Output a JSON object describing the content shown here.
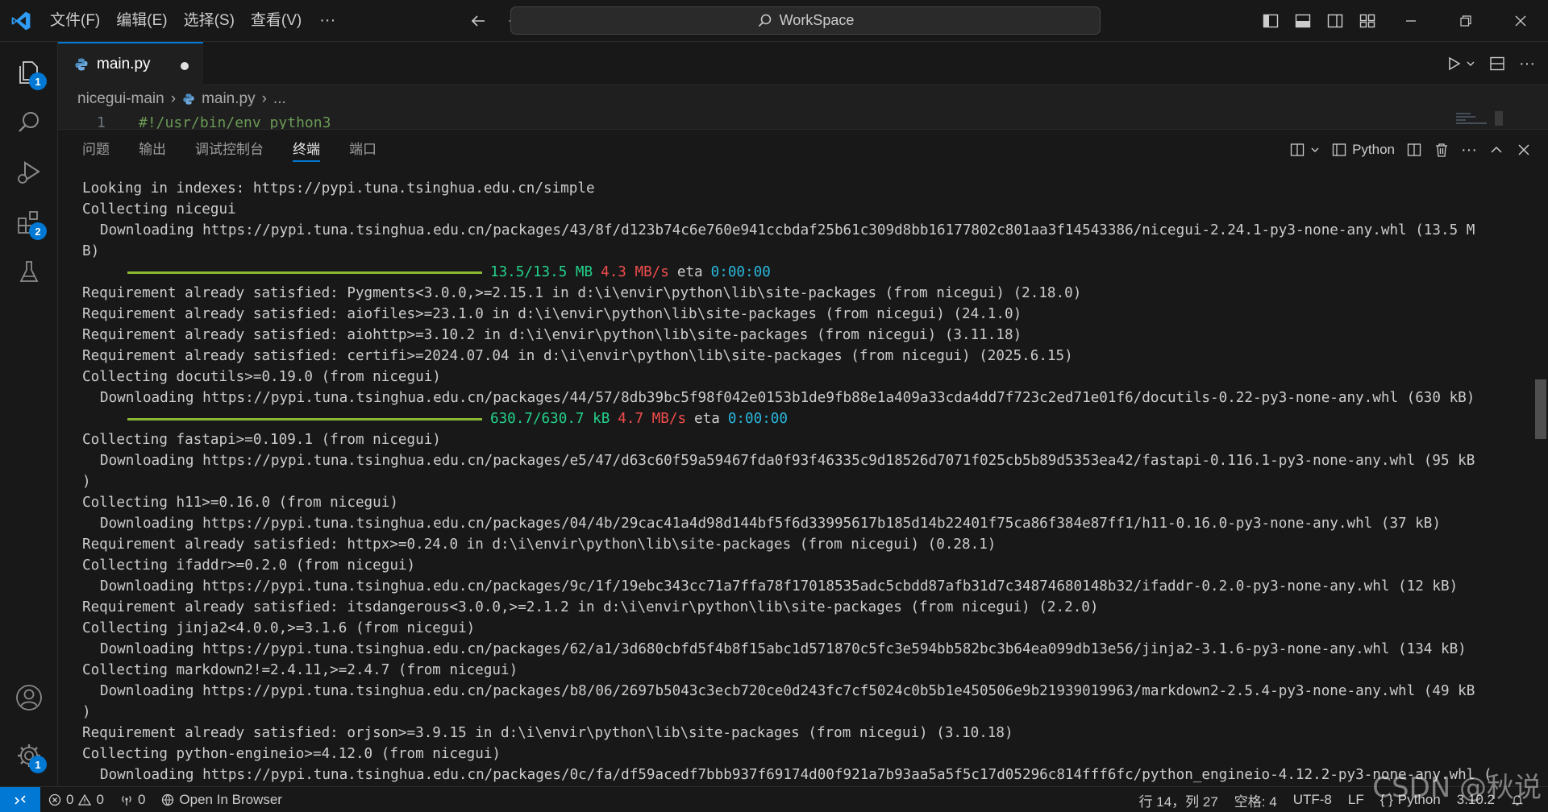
{
  "menu": [
    "文件(F)",
    "编辑(E)",
    "选择(S)",
    "查看(V)"
  ],
  "search": {
    "label": "WorkSpace"
  },
  "activity_badges": {
    "explorer": "1",
    "extensions": "2",
    "settings": "1"
  },
  "tabs": [
    {
      "label": "main.py",
      "dirty": true
    }
  ],
  "breadcrumb": {
    "folder": "nicegui-main",
    "file": "main.py",
    "more": "..."
  },
  "editor": {
    "line_no": "1",
    "code": "#!/usr/bin/env python3"
  },
  "panel": {
    "tabs": [
      "问题",
      "输出",
      "调试控制台",
      "终端",
      "端口"
    ],
    "active_tab": "终端",
    "terminal_profile": "Python"
  },
  "terminal": {
    "lines": [
      {
        "text": "Looking in indexes: https://pypi.tuna.tsinghua.edu.cn/simple"
      },
      {
        "text": "Collecting nicegui"
      },
      {
        "text": "Downloading https://pypi.tuna.tsinghua.edu.cn/packages/43/8f/d123b74c6e760e941ccbdaf25b61c309d8bb16177802c801aa3f14543386/nicegui-2.24.1-py3-none-any.whl (13.5 M",
        "indent": true
      },
      {
        "text": "B)"
      },
      {
        "progress": {
          "size": "13.5/13.5 MB",
          "rate": "4.3 MB/s",
          "eta_label": "eta",
          "eta": "0:00:00",
          "fraction": 1.0
        }
      },
      {
        "text": "Requirement already satisfied: Pygments<3.0.0,>=2.15.1 in d:\\i\\envir\\python\\lib\\site-packages (from nicegui) (2.18.0)"
      },
      {
        "text": "Requirement already satisfied: aiofiles>=23.1.0 in d:\\i\\envir\\python\\lib\\site-packages (from nicegui) (24.1.0)"
      },
      {
        "text": "Requirement already satisfied: aiohttp>=3.10.2 in d:\\i\\envir\\python\\lib\\site-packages (from nicegui) (3.11.18)"
      },
      {
        "text": "Requirement already satisfied: certifi>=2024.07.04 in d:\\i\\envir\\python\\lib\\site-packages (from nicegui) (2025.6.15)"
      },
      {
        "text": "Collecting docutils>=0.19.0 (from nicegui)"
      },
      {
        "text": "Downloading https://pypi.tuna.tsinghua.edu.cn/packages/44/57/8db39bc5f98f042e0153b1de9fb88e1a409a33cda4dd7f723c2ed71e01f6/docutils-0.22-py3-none-any.whl (630 kB)",
        "indent": true
      },
      {
        "progress": {
          "size": "630.7/630.7 kB",
          "rate": "4.7 MB/s",
          "eta_label": "eta",
          "eta": "0:00:00",
          "fraction": 1.0
        }
      },
      {
        "text": "Collecting fastapi>=0.109.1 (from nicegui)"
      },
      {
        "text": "Downloading https://pypi.tuna.tsinghua.edu.cn/packages/e5/47/d63c60f59a59467fda0f93f46335c9d18526d7071f025cb5b89d5353ea42/fastapi-0.116.1-py3-none-any.whl (95 kB",
        "indent": true
      },
      {
        "text": ")"
      },
      {
        "text": "Collecting h11>=0.16.0 (from nicegui)"
      },
      {
        "text": "Downloading https://pypi.tuna.tsinghua.edu.cn/packages/04/4b/29cac41a4d98d144bf5f6d33995617b185d14b22401f75ca86f384e87ff1/h11-0.16.0-py3-none-any.whl (37 kB)",
        "indent": true
      },
      {
        "text": "Requirement already satisfied: httpx>=0.24.0 in d:\\i\\envir\\python\\lib\\site-packages (from nicegui) (0.28.1)"
      },
      {
        "text": "Collecting ifaddr>=0.2.0 (from nicegui)"
      },
      {
        "text": "Downloading https://pypi.tuna.tsinghua.edu.cn/packages/9c/1f/19ebc343cc71a7ffa78f17018535adc5cbdd87afb31d7c34874680148b32/ifaddr-0.2.0-py3-none-any.whl (12 kB)",
        "indent": true
      },
      {
        "text": "Requirement already satisfied: itsdangerous<3.0.0,>=2.1.2 in d:\\i\\envir\\python\\lib\\site-packages (from nicegui) (2.2.0)"
      },
      {
        "text": "Collecting jinja2<4.0.0,>=3.1.6 (from nicegui)"
      },
      {
        "text": "Downloading https://pypi.tuna.tsinghua.edu.cn/packages/62/a1/3d680cbfd5f4b8f15abc1d571870c5fc3e594bb582bc3b64ea099db13e56/jinja2-3.1.6-py3-none-any.whl (134 kB)",
        "indent": true
      },
      {
        "text": "Collecting markdown2!=2.4.11,>=2.4.7 (from nicegui)"
      },
      {
        "text": "Downloading https://pypi.tuna.tsinghua.edu.cn/packages/b8/06/2697b5043c3ecb720ce0d243fc7cf5024c0b5b1e450506e9b21939019963/markdown2-2.5.4-py3-none-any.whl (49 kB",
        "indent": true
      },
      {
        "text": ")"
      },
      {
        "text": "Requirement already satisfied: orjson>=3.9.15 in d:\\i\\envir\\python\\lib\\site-packages (from nicegui) (3.10.18)"
      },
      {
        "text": "Collecting python-engineio>=4.12.0 (from nicegui)"
      },
      {
        "text": "Downloading https://pypi.tuna.tsinghua.edu.cn/packages/0c/fa/df59acedf7bbb937f69174d00f921a7b93aa5a5f5c17d05296c814fff6fc/python_engineio-4.12.2-py3-none-any.whl (",
        "indent": true
      }
    ]
  },
  "status": {
    "errors": "0",
    "warnings": "0",
    "ports": "0",
    "open_browser": "Open In Browser",
    "position": "行 14，列 27",
    "spaces": "空格: 4",
    "encoding": "UTF-8",
    "eol": "LF",
    "language": "Python",
    "version": "3.10.2"
  },
  "watermark": "CSDN @秋说",
  "colors": {
    "accent": "#0078d4",
    "progress": "#8ab833",
    "size": "#23d18b",
    "rate": "#f14c4c",
    "eta": "#29b8db"
  }
}
